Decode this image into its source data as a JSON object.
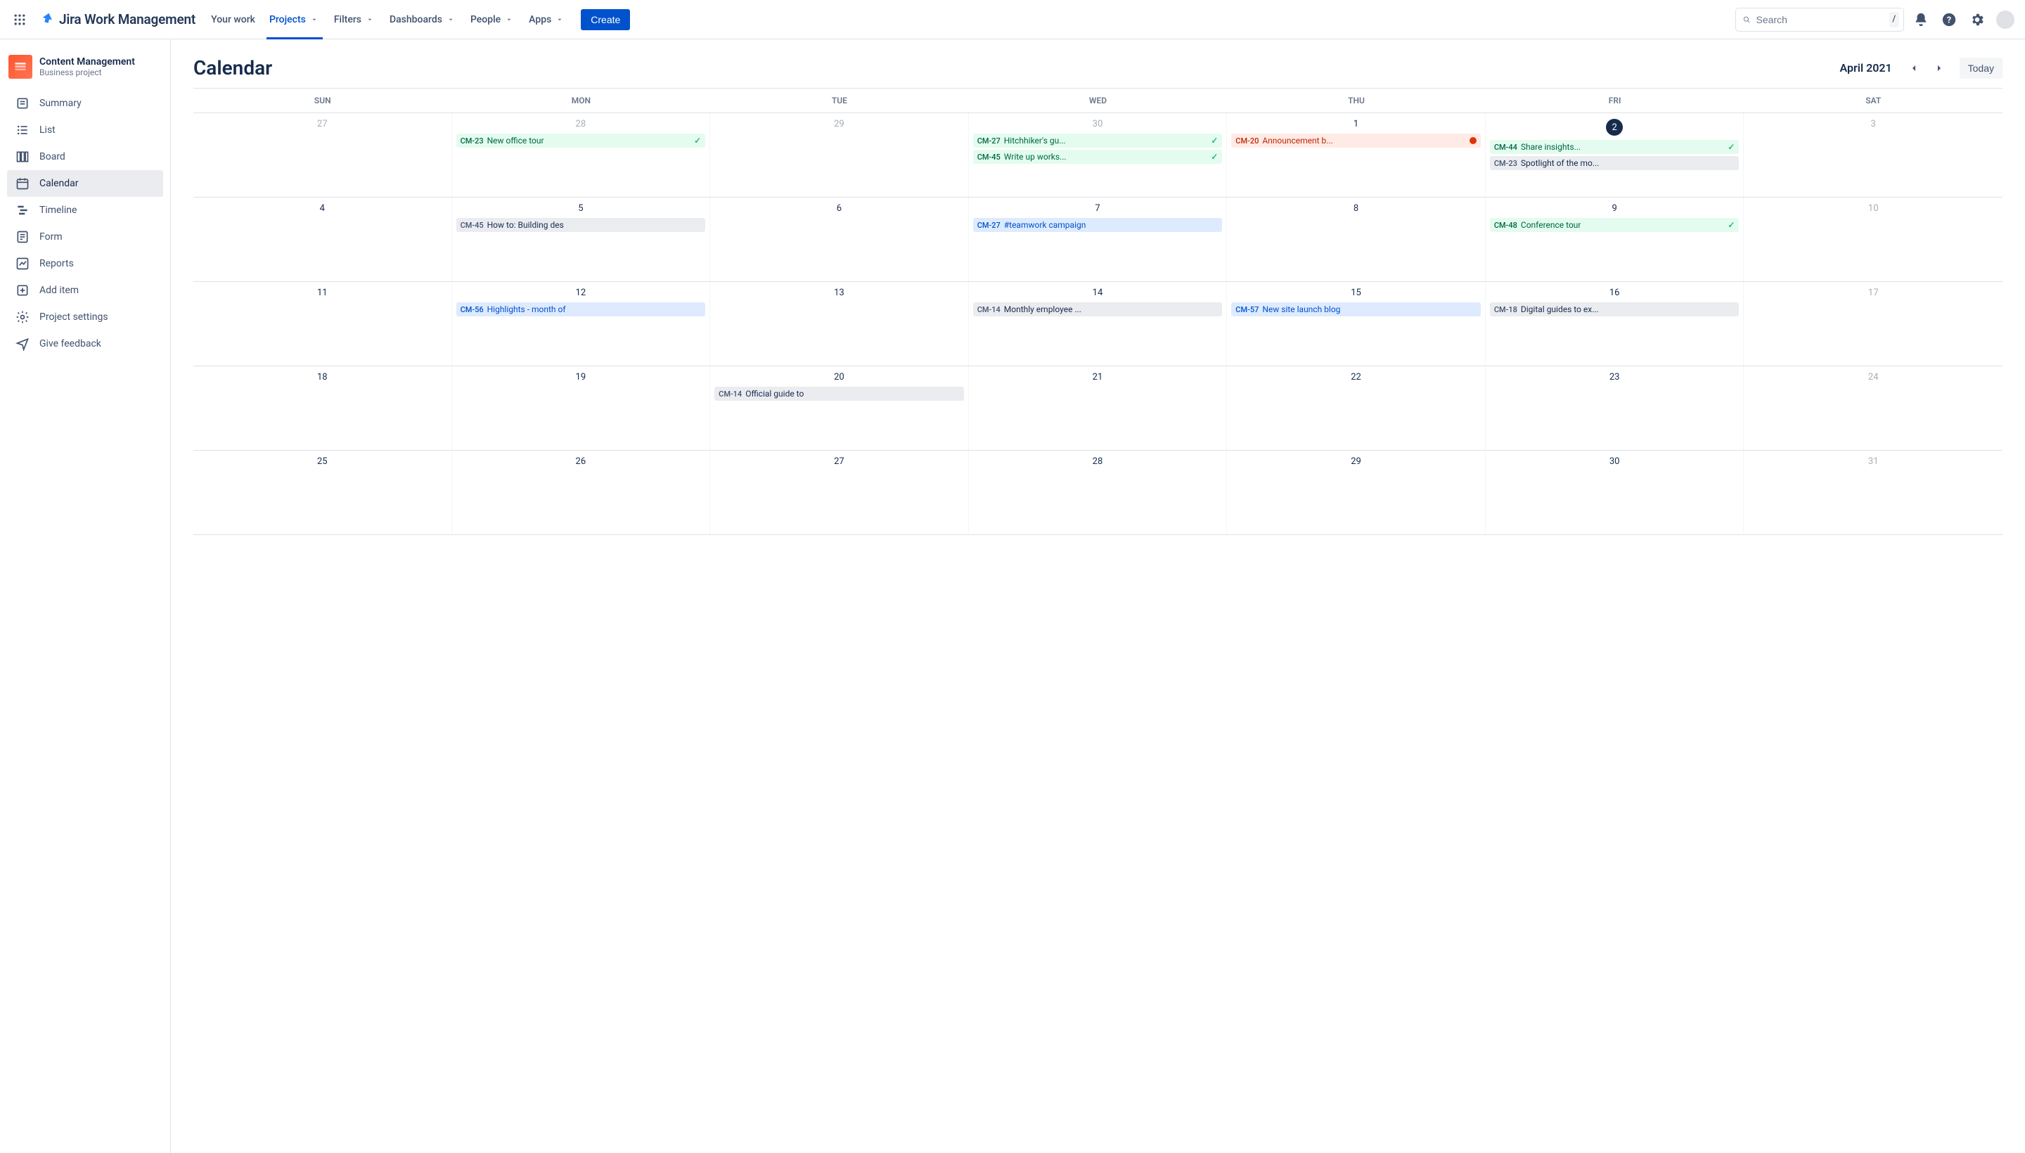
{
  "header": {
    "product": "Jira Work Management",
    "nav": [
      {
        "label": "Your work",
        "dropdown": false
      },
      {
        "label": "Projects",
        "dropdown": true,
        "active": true
      },
      {
        "label": "Filters",
        "dropdown": true
      },
      {
        "label": "Dashboards",
        "dropdown": true
      },
      {
        "label": "People",
        "dropdown": true
      },
      {
        "label": "Apps",
        "dropdown": true
      }
    ],
    "create_label": "Create",
    "search_placeholder": "Search",
    "search_hint": "/"
  },
  "sidebar": {
    "project_name": "Content Management",
    "project_type": "Business project",
    "items": [
      {
        "icon": "summary",
        "label": "Summary"
      },
      {
        "icon": "list",
        "label": "List"
      },
      {
        "icon": "board",
        "label": "Board"
      },
      {
        "icon": "calendar",
        "label": "Calendar",
        "active": true
      },
      {
        "icon": "timeline",
        "label": "Timeline"
      },
      {
        "icon": "form",
        "label": "Form"
      },
      {
        "icon": "reports",
        "label": "Reports"
      },
      {
        "icon": "add",
        "label": "Add item"
      },
      {
        "icon": "settings",
        "label": "Project settings"
      },
      {
        "icon": "feedback",
        "label": "Give feedback"
      }
    ]
  },
  "calendar": {
    "title": "Calendar",
    "month_label": "April 2021",
    "today_label": "Today",
    "dow": [
      "SUN",
      "MON",
      "TUE",
      "WED",
      "THU",
      "FRI",
      "SAT"
    ],
    "weeks": [
      {
        "days": [
          {
            "num": "27",
            "dim": true,
            "events": []
          },
          {
            "num": "28",
            "dim": true,
            "events": [
              {
                "key": "CM-23",
                "title": "New office tour",
                "style": "green",
                "check": true
              }
            ]
          },
          {
            "num": "29",
            "dim": true,
            "events": []
          },
          {
            "num": "30",
            "dim": true,
            "events": [
              {
                "key": "CM-27",
                "title": "Hitchhiker's gu...",
                "style": "green",
                "check": true
              },
              {
                "key": "CM-45",
                "title": "Write up works...",
                "style": "green",
                "check": true
              }
            ]
          },
          {
            "num": "1",
            "events": [
              {
                "key": "CM-20",
                "title": "Announcement b...",
                "style": "red",
                "dot": true
              }
            ]
          },
          {
            "num": "2",
            "today": true,
            "events": [
              {
                "key": "CM-44",
                "title": "Share insights...",
                "style": "green",
                "check": true
              },
              {
                "key": "CM-23",
                "title": "Spotlight of the mo...",
                "style": "gray"
              }
            ]
          },
          {
            "num": "3",
            "dim": true,
            "events": []
          }
        ]
      },
      {
        "days": [
          {
            "num": "4",
            "events": []
          },
          {
            "num": "5",
            "events": [
              {
                "key": "CM-45",
                "title": "How to: Building des",
                "style": "gray"
              }
            ]
          },
          {
            "num": "6",
            "events": []
          },
          {
            "num": "7",
            "events": [
              {
                "key": "CM-27",
                "title": "#teamwork campaign",
                "style": "blue"
              }
            ]
          },
          {
            "num": "8",
            "events": []
          },
          {
            "num": "9",
            "events": [
              {
                "key": "CM-48",
                "title": "Conference tour",
                "style": "green",
                "check": true
              }
            ]
          },
          {
            "num": "10",
            "dim": true,
            "events": []
          }
        ]
      },
      {
        "days": [
          {
            "num": "11",
            "events": []
          },
          {
            "num": "12",
            "events": [
              {
                "key": "CM-56",
                "title": "Highlights - month of",
                "style": "blue"
              }
            ]
          },
          {
            "num": "13",
            "events": []
          },
          {
            "num": "14",
            "events": [
              {
                "key": "CM-14",
                "title": "Monthly employee ...",
                "style": "gray"
              }
            ]
          },
          {
            "num": "15",
            "events": [
              {
                "key": "CM-57",
                "title": "New site launch blog",
                "style": "blue"
              }
            ]
          },
          {
            "num": "16",
            "events": [
              {
                "key": "CM-18",
                "title": "Digital guides to ex...",
                "style": "gray"
              }
            ]
          },
          {
            "num": "17",
            "dim": true,
            "events": []
          }
        ]
      },
      {
        "days": [
          {
            "num": "18",
            "events": []
          },
          {
            "num": "19",
            "events": []
          },
          {
            "num": "20",
            "events": [
              {
                "key": "CM-14",
                "title": "Official guide to",
                "style": "gray"
              }
            ]
          },
          {
            "num": "21",
            "events": []
          },
          {
            "num": "22",
            "events": []
          },
          {
            "num": "23",
            "events": []
          },
          {
            "num": "24",
            "dim": true,
            "events": []
          }
        ]
      },
      {
        "days": [
          {
            "num": "25",
            "events": []
          },
          {
            "num": "26",
            "events": []
          },
          {
            "num": "27",
            "events": []
          },
          {
            "num": "28",
            "events": []
          },
          {
            "num": "29",
            "events": []
          },
          {
            "num": "30",
            "events": []
          },
          {
            "num": "31",
            "dim": true,
            "events": []
          }
        ]
      }
    ]
  }
}
